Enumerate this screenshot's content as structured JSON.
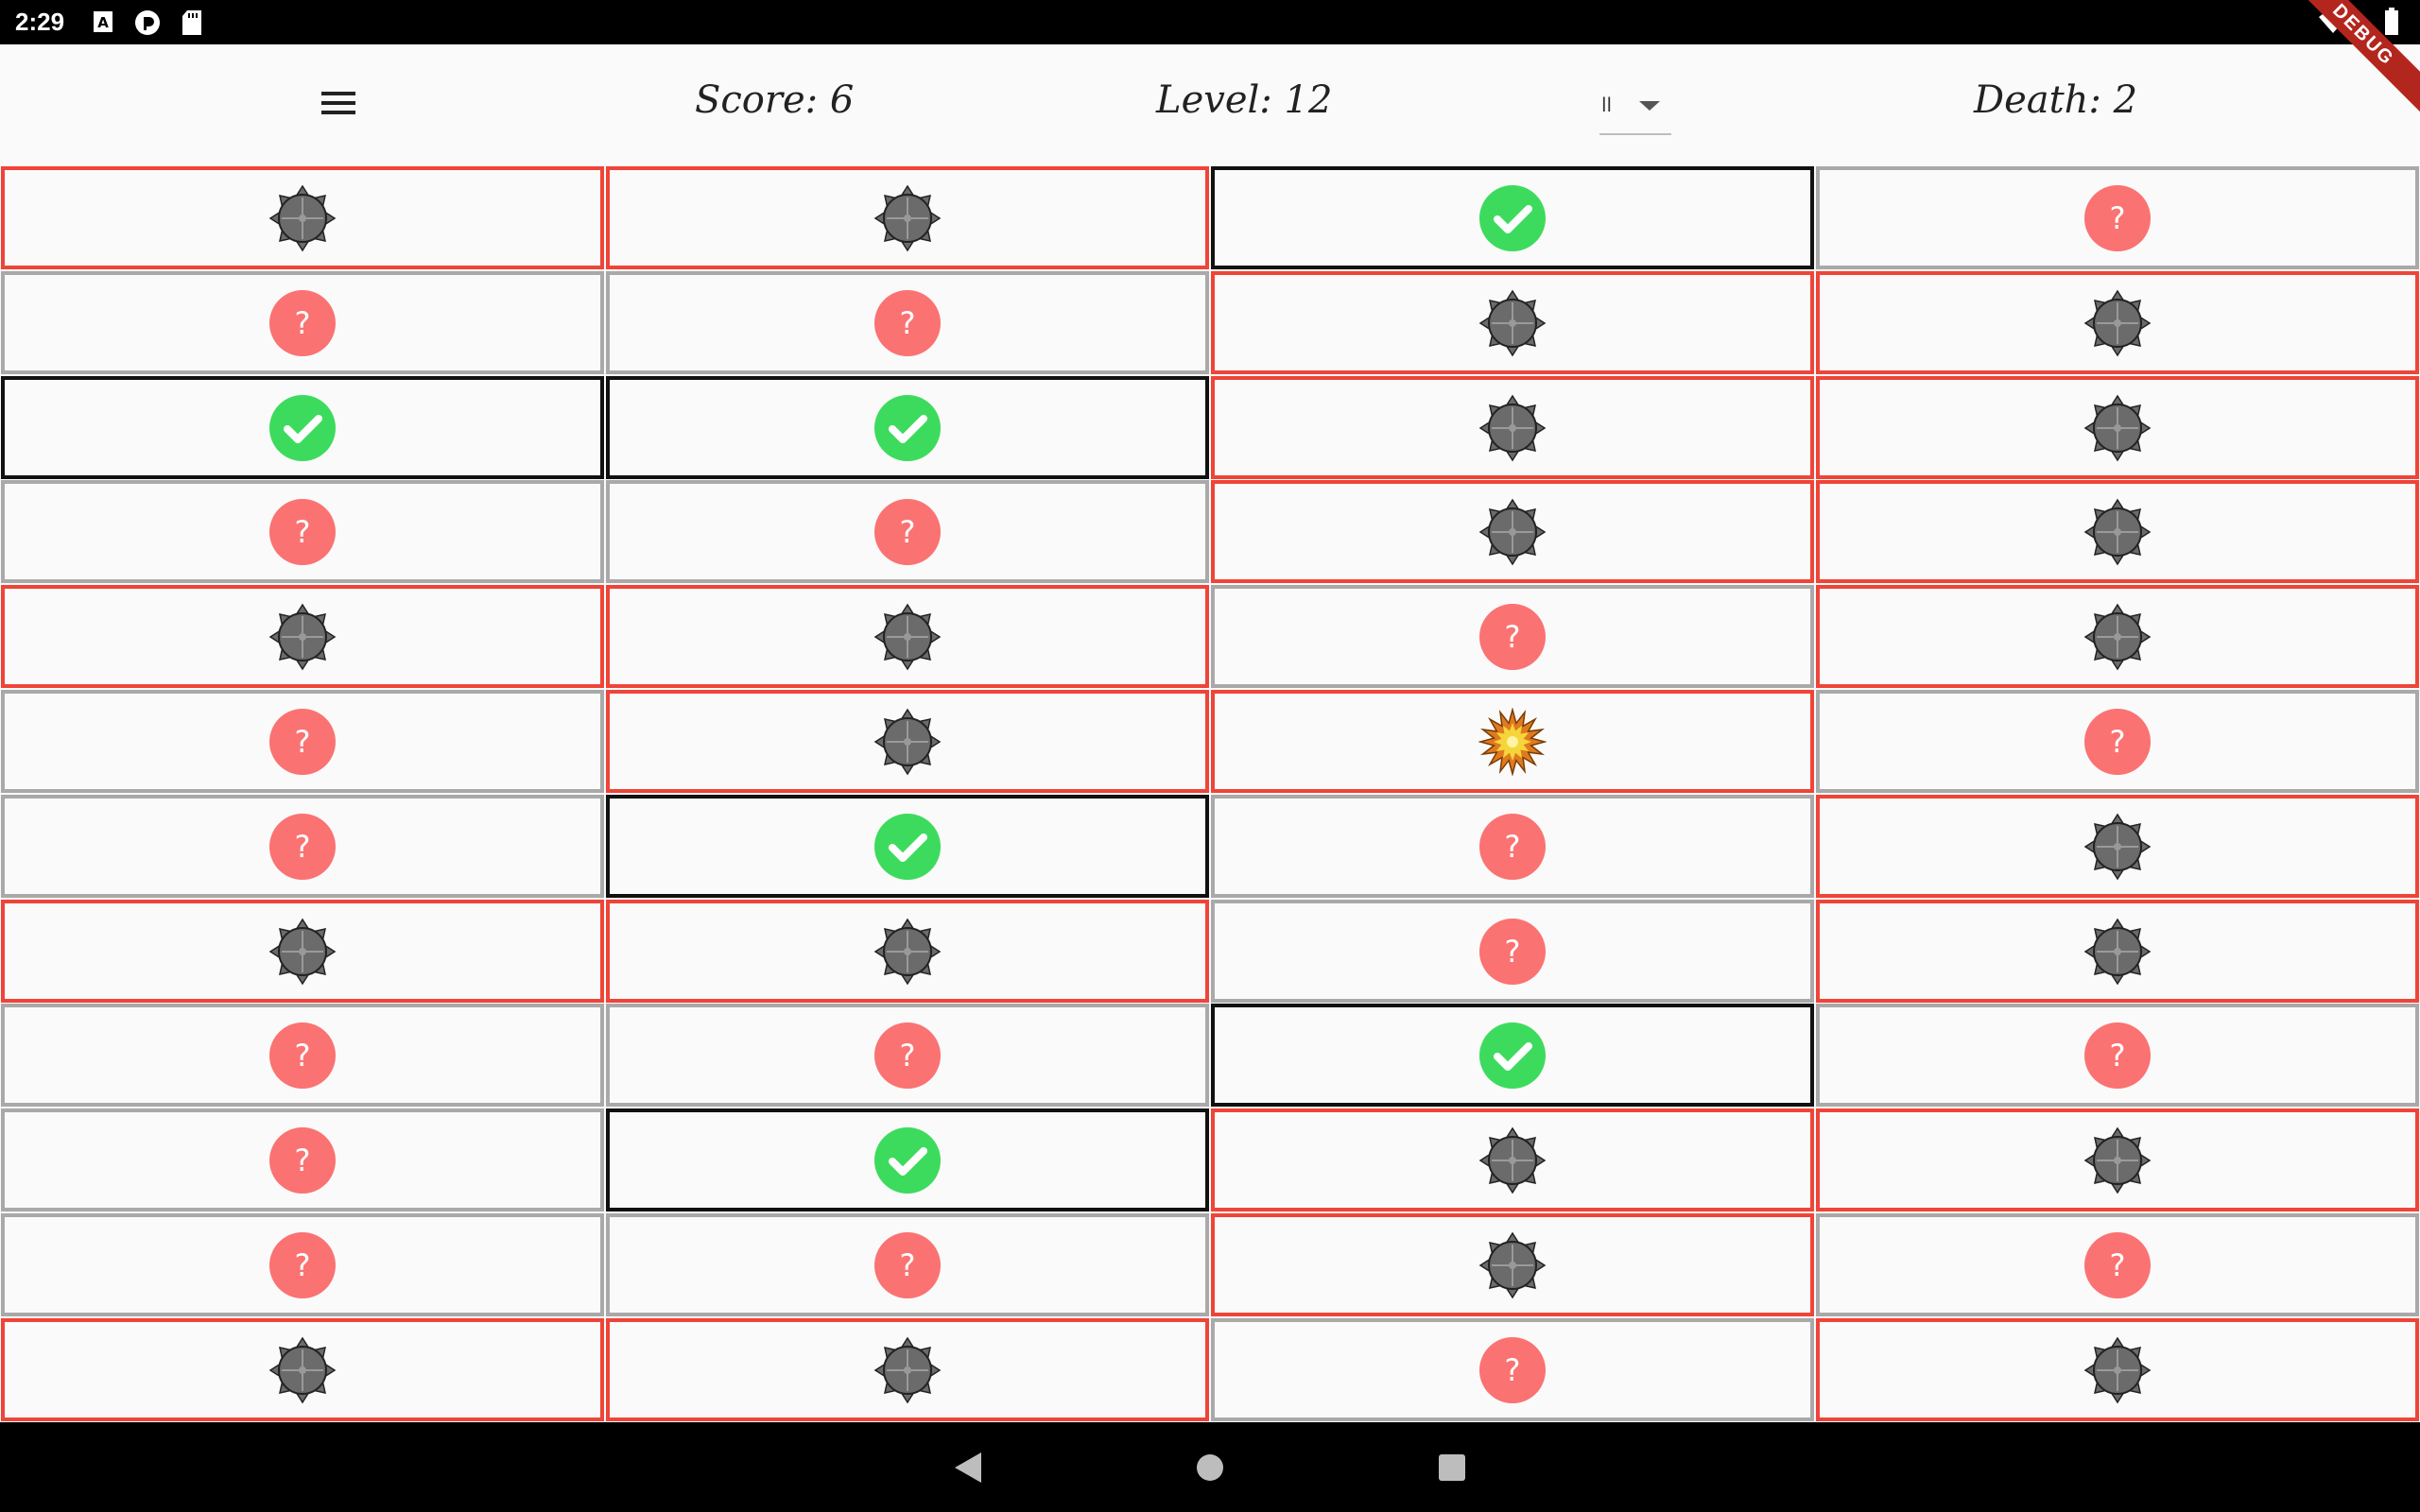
{
  "status_bar": {
    "time": "2:29",
    "icons_left": [
      "a-notification-icon",
      "pocket-casts-icon",
      "sd-card-icon"
    ],
    "icons_right": [
      "wifi-icon",
      "battery-icon"
    ]
  },
  "debug_banner": "DEBUG",
  "header": {
    "menu_icon": "menu-icon",
    "score": "Score: 6",
    "level": "Level: 12",
    "difficulty_value": "ll",
    "death": "Death: 2"
  },
  "board": {
    "columns": 4,
    "rows": 12,
    "legend": {
      "unknown": "question-icon",
      "mine": "mine-icon",
      "safe": "check-icon",
      "exploded": "explosion-icon"
    },
    "cells": [
      [
        "mine",
        "mine",
        "safe",
        "unknown"
      ],
      [
        "unknown",
        "unknown",
        "mine",
        "mine"
      ],
      [
        "safe",
        "safe",
        "mine",
        "mine"
      ],
      [
        "unknown",
        "unknown",
        "mine",
        "mine"
      ],
      [
        "mine",
        "mine",
        "unknown",
        "mine"
      ],
      [
        "unknown",
        "mine",
        "exploded",
        "unknown"
      ],
      [
        "unknown",
        "safe",
        "unknown",
        "mine"
      ],
      [
        "mine",
        "mine",
        "unknown",
        "mine"
      ],
      [
        "unknown",
        "unknown",
        "safe",
        "unknown"
      ],
      [
        "unknown",
        "safe",
        "mine",
        "mine"
      ],
      [
        "unknown",
        "unknown",
        "mine",
        "unknown"
      ],
      [
        "mine",
        "mine",
        "unknown",
        "mine"
      ]
    ]
  },
  "colors": {
    "mine_border": "#ef4438",
    "safe_border": "#111111",
    "unknown_border": "#a9a9a9",
    "question_circle": "#fb7272",
    "check_circle": "#3ddb5d",
    "mine_fill": "#6b6b6b"
  },
  "nav_bar": {
    "buttons": [
      "back-icon",
      "home-icon",
      "recents-icon"
    ]
  }
}
